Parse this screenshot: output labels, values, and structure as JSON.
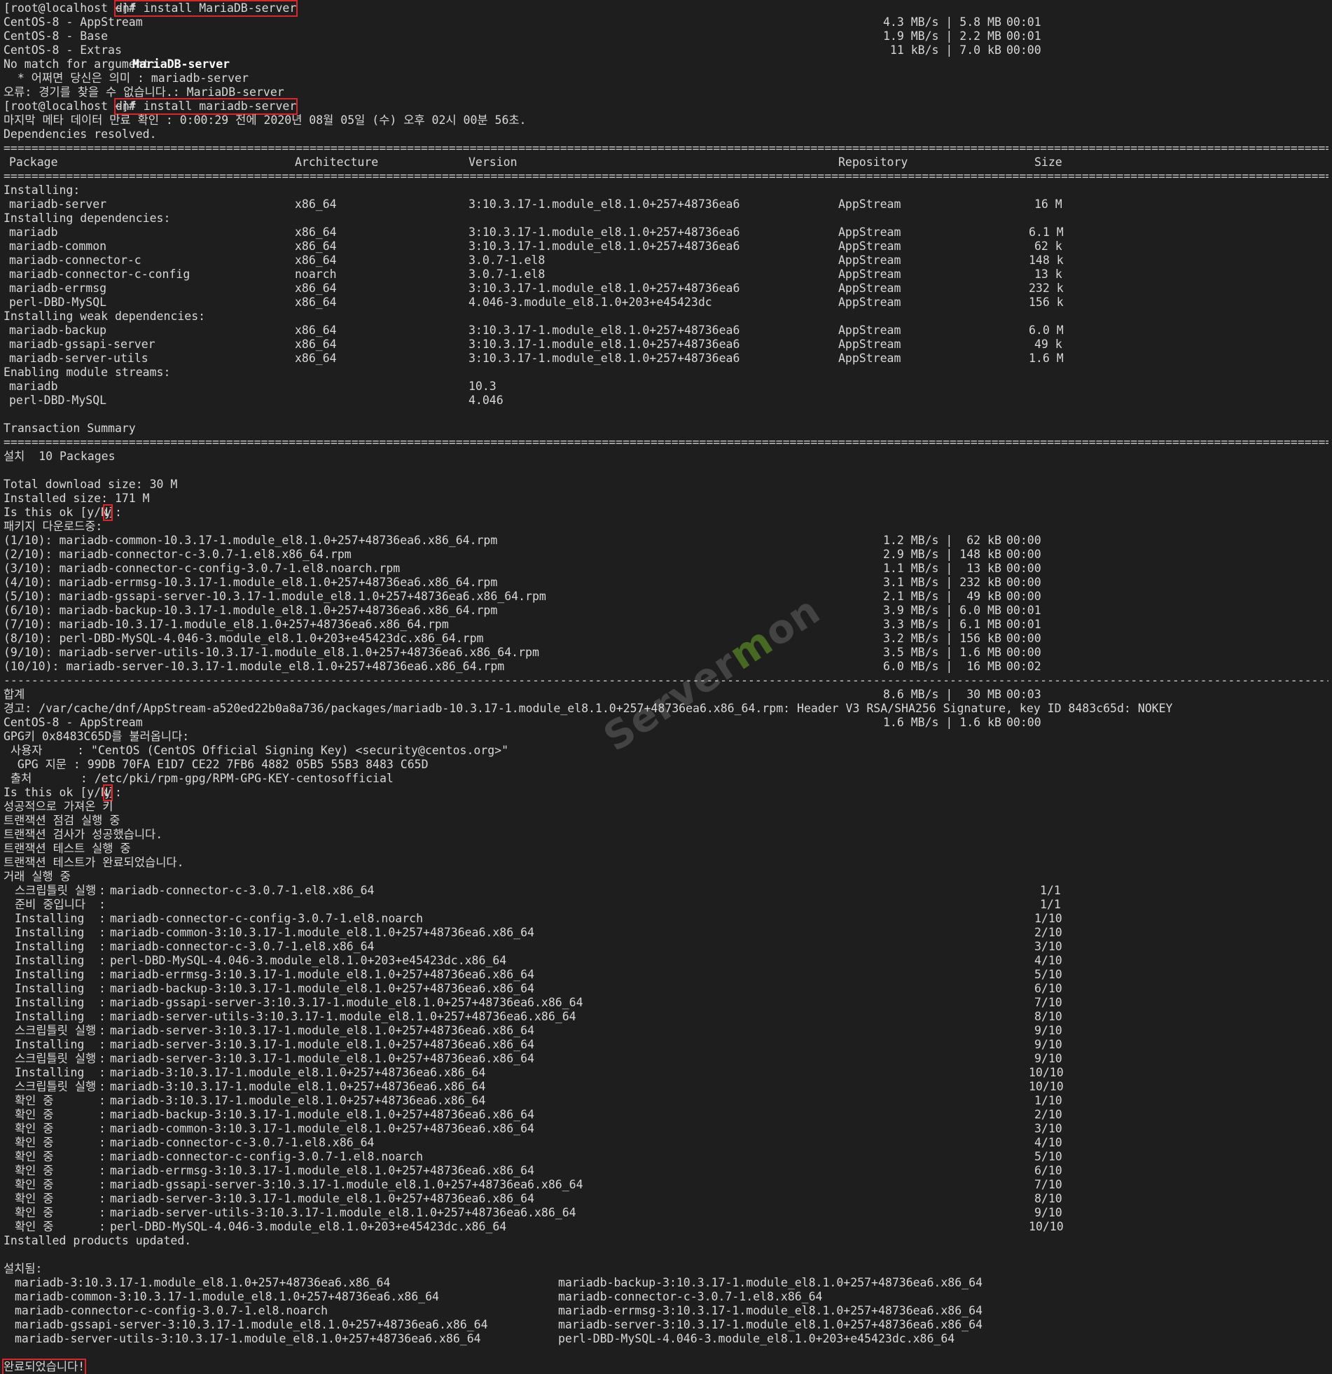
{
  "terminal": {
    "prompt": "[root@localhost ~]#",
    "cmd_wrong": "dnf install MariaDB-server",
    "cmd_right": "dnf install mariadb-server",
    "repo_lines": [
      {
        "name": "CentOS-8 - AppStream",
        "rate": "4.3 MB/s | 5.8 MB",
        "time": "00:01"
      },
      {
        "name": "CentOS-8 - Base",
        "rate": "1.9 MB/s | 2.2 MB",
        "time": "00:01"
      },
      {
        "name": "CentOS-8 - Extras",
        "rate": " 11 kB/s | 7.0 kB",
        "time": "00:00"
      }
    ],
    "no_match_prefix": "No match for argument: ",
    "no_match_pkg": "MariaDB-server",
    "suggest": "  * 어쩌면 당신은 의미 : mariadb-server",
    "error_line": "오류: 경기를 찾을 수 없습니다.: MariaDB-server",
    "metadata_line": "마지막 메타 데이터 만료 확인 : 0:00:29 전에 2020년 08월 05일 (수) 오후 02시 00분 56초.",
    "deps_resolved": "Dependencies resolved.",
    "header": {
      "package": "Package",
      "arch": "Architecture",
      "version": "Version",
      "repo": "Repository",
      "size": "Size"
    },
    "sections": [
      {
        "title": "Installing:",
        "rows": [
          {
            "pkg": "mariadb-server",
            "arch": "x86_64",
            "ver": "3:10.3.17-1.module_el8.1.0+257+48736ea6",
            "repo": "AppStream",
            "size": "16 M"
          }
        ]
      },
      {
        "title": "Installing dependencies:",
        "rows": [
          {
            "pkg": "mariadb",
            "arch": "x86_64",
            "ver": "3:10.3.17-1.module_el8.1.0+257+48736ea6",
            "repo": "AppStream",
            "size": "6.1 M"
          },
          {
            "pkg": "mariadb-common",
            "arch": "x86_64",
            "ver": "3:10.3.17-1.module_el8.1.0+257+48736ea6",
            "repo": "AppStream",
            "size": "62 k"
          },
          {
            "pkg": "mariadb-connector-c",
            "arch": "x86_64",
            "ver": "3.0.7-1.el8",
            "repo": "AppStream",
            "size": "148 k"
          },
          {
            "pkg": "mariadb-connector-c-config",
            "arch": "noarch",
            "ver": "3.0.7-1.el8",
            "repo": "AppStream",
            "size": "13 k"
          },
          {
            "pkg": "mariadb-errmsg",
            "arch": "x86_64",
            "ver": "3:10.3.17-1.module_el8.1.0+257+48736ea6",
            "repo": "AppStream",
            "size": "232 k"
          },
          {
            "pkg": "perl-DBD-MySQL",
            "arch": "x86_64",
            "ver": "4.046-3.module_el8.1.0+203+e45423dc",
            "repo": "AppStream",
            "size": "156 k"
          }
        ]
      },
      {
        "title": "Installing weak dependencies:",
        "rows": [
          {
            "pkg": "mariadb-backup",
            "arch": "x86_64",
            "ver": "3:10.3.17-1.module_el8.1.0+257+48736ea6",
            "repo": "AppStream",
            "size": "6.0 M"
          },
          {
            "pkg": "mariadb-gssapi-server",
            "arch": "x86_64",
            "ver": "3:10.3.17-1.module_el8.1.0+257+48736ea6",
            "repo": "AppStream",
            "size": "49 k"
          },
          {
            "pkg": "mariadb-server-utils",
            "arch": "x86_64",
            "ver": "3:10.3.17-1.module_el8.1.0+257+48736ea6",
            "repo": "AppStream",
            "size": "1.6 M"
          }
        ]
      },
      {
        "title": "Enabling module streams:",
        "rows": [
          {
            "pkg": "mariadb",
            "arch": "",
            "ver": "10.3",
            "repo": "",
            "size": ""
          },
          {
            "pkg": "perl-DBD-MySQL",
            "arch": "",
            "ver": "4.046",
            "repo": "",
            "size": ""
          }
        ]
      }
    ],
    "txn_summary": "Transaction Summary",
    "install_count": "설치  10 Packages",
    "total_download": "Total download size: 30 M",
    "installed_size": "Installed size: 171 M",
    "ok_prompt": "Is this ok [y/N]: ",
    "answer": "y",
    "downloading": "패키지 다운로드중:",
    "downloads": [
      {
        "file": "(1/10): mariadb-common-10.3.17-1.module_el8.1.0+257+48736ea6.x86_64.rpm",
        "rate": "1.2 MB/s |  62 kB",
        "time": "00:00"
      },
      {
        "file": "(2/10): mariadb-connector-c-3.0.7-1.el8.x86_64.rpm",
        "rate": "2.9 MB/s | 148 kB",
        "time": "00:00"
      },
      {
        "file": "(3/10): mariadb-connector-c-config-3.0.7-1.el8.noarch.rpm",
        "rate": "1.1 MB/s |  13 kB",
        "time": "00:00"
      },
      {
        "file": "(4/10): mariadb-errmsg-10.3.17-1.module_el8.1.0+257+48736ea6.x86_64.rpm",
        "rate": "3.1 MB/s | 232 kB",
        "time": "00:00"
      },
      {
        "file": "(5/10): mariadb-gssapi-server-10.3.17-1.module_el8.1.0+257+48736ea6.x86_64.rpm",
        "rate": "2.1 MB/s |  49 kB",
        "time": "00:00"
      },
      {
        "file": "(6/10): mariadb-backup-10.3.17-1.module_el8.1.0+257+48736ea6.x86_64.rpm",
        "rate": "3.9 MB/s | 6.0 MB",
        "time": "00:01"
      },
      {
        "file": "(7/10): mariadb-10.3.17-1.module_el8.1.0+257+48736ea6.x86_64.rpm",
        "rate": "3.3 MB/s | 6.1 MB",
        "time": "00:01"
      },
      {
        "file": "(8/10): perl-DBD-MySQL-4.046-3.module_el8.1.0+203+e45423dc.x86_64.rpm",
        "rate": "3.2 MB/s | 156 kB",
        "time": "00:00"
      },
      {
        "file": "(9/10): mariadb-server-utils-10.3.17-1.module_el8.1.0+257+48736ea6.x86_64.rpm",
        "rate": "3.5 MB/s | 1.6 MB",
        "time": "00:00"
      },
      {
        "file": "(10/10): mariadb-server-10.3.17-1.module_el8.1.0+257+48736ea6.x86_64.rpm",
        "rate": "6.0 MB/s |  16 MB",
        "time": "00:02"
      }
    ],
    "total_label": "합계",
    "total_rate": "8.6 MB/s |  30 MB",
    "total_time": "00:03",
    "warning_line": "경고: /var/cache/dnf/AppStream-a520ed22b0a8a736/packages/mariadb-10.3.17-1.module_el8.1.0+257+48736ea6.x86_64.rpm: Header V3 RSA/SHA256 Signature, key ID 8483c65d: NOKEY",
    "appstream_line": {
      "name": "CentOS-8 - AppStream",
      "rate": "1.6 MB/s | 1.6 kB",
      "time": "00:00"
    },
    "gpg_lines": [
      "GPG키 0x8483C65D를 불러옵니다:",
      " 사용자     : \"CentOS (CentOS Official Signing Key) <security@centos.org>\"",
      "  GPG 지문 : 99DB 70FA E1D7 CE22 7FB6 4882 05B5 55B3 8483 C65D",
      " 출처       : /etc/pki/rpm-gpg/RPM-GPG-KEY-centosofficial"
    ],
    "post_lines": [
      "성공적으로 가져온 키",
      "트랜잭션 점검 실행 중",
      "트랜잭션 검사가 성공했습니다.",
      "트랜잭션 테스트 실행 중",
      "트랜잭션 테스트가 완료되었습니다.",
      "거래 실행 중"
    ],
    "steps": [
      {
        "action": "스크립틀릿 실행",
        "pkg": "mariadb-connector-c-3.0.7-1.el8.x86_64",
        "prog": "1/1"
      },
      {
        "action": "준비 중입니다",
        "pkg": "",
        "prog": "1/1"
      },
      {
        "action": "Installing",
        "pkg": "mariadb-connector-c-config-3.0.7-1.el8.noarch",
        "prog": "1/10"
      },
      {
        "action": "Installing",
        "pkg": "mariadb-common-3:10.3.17-1.module_el8.1.0+257+48736ea6.x86_64",
        "prog": "2/10"
      },
      {
        "action": "Installing",
        "pkg": "mariadb-connector-c-3.0.7-1.el8.x86_64",
        "prog": "3/10"
      },
      {
        "action": "Installing",
        "pkg": "perl-DBD-MySQL-4.046-3.module_el8.1.0+203+e45423dc.x86_64",
        "prog": "4/10"
      },
      {
        "action": "Installing",
        "pkg": "mariadb-errmsg-3:10.3.17-1.module_el8.1.0+257+48736ea6.x86_64",
        "prog": "5/10"
      },
      {
        "action": "Installing",
        "pkg": "mariadb-backup-3:10.3.17-1.module_el8.1.0+257+48736ea6.x86_64",
        "prog": "6/10"
      },
      {
        "action": "Installing",
        "pkg": "mariadb-gssapi-server-3:10.3.17-1.module_el8.1.0+257+48736ea6.x86_64",
        "prog": "7/10"
      },
      {
        "action": "Installing",
        "pkg": "mariadb-server-utils-3:10.3.17-1.module_el8.1.0+257+48736ea6.x86_64",
        "prog": "8/10"
      },
      {
        "action": "스크립틀릿 실행",
        "pkg": "mariadb-server-3:10.3.17-1.module_el8.1.0+257+48736ea6.x86_64",
        "prog": "9/10"
      },
      {
        "action": "Installing",
        "pkg": "mariadb-server-3:10.3.17-1.module_el8.1.0+257+48736ea6.x86_64",
        "prog": "9/10"
      },
      {
        "action": "스크립틀릿 실행",
        "pkg": "mariadb-server-3:10.3.17-1.module_el8.1.0+257+48736ea6.x86_64",
        "prog": "9/10"
      },
      {
        "action": "Installing",
        "pkg": "mariadb-3:10.3.17-1.module_el8.1.0+257+48736ea6.x86_64",
        "prog": "10/10"
      },
      {
        "action": "스크립틀릿 실행",
        "pkg": "mariadb-3:10.3.17-1.module_el8.1.0+257+48736ea6.x86_64",
        "prog": "10/10"
      },
      {
        "action": "확인 중",
        "pkg": "mariadb-3:10.3.17-1.module_el8.1.0+257+48736ea6.x86_64",
        "prog": "1/10"
      },
      {
        "action": "확인 중",
        "pkg": "mariadb-backup-3:10.3.17-1.module_el8.1.0+257+48736ea6.x86_64",
        "prog": "2/10"
      },
      {
        "action": "확인 중",
        "pkg": "mariadb-common-3:10.3.17-1.module_el8.1.0+257+48736ea6.x86_64",
        "prog": "3/10"
      },
      {
        "action": "확인 중",
        "pkg": "mariadb-connector-c-3.0.7-1.el8.x86_64",
        "prog": "4/10"
      },
      {
        "action": "확인 중",
        "pkg": "mariadb-connector-c-config-3.0.7-1.el8.noarch",
        "prog": "5/10"
      },
      {
        "action": "확인 중",
        "pkg": "mariadb-errmsg-3:10.3.17-1.module_el8.1.0+257+48736ea6.x86_64",
        "prog": "6/10"
      },
      {
        "action": "확인 중",
        "pkg": "mariadb-gssapi-server-3:10.3.17-1.module_el8.1.0+257+48736ea6.x86_64",
        "prog": "7/10"
      },
      {
        "action": "확인 중",
        "pkg": "mariadb-server-3:10.3.17-1.module_el8.1.0+257+48736ea6.x86_64",
        "prog": "8/10"
      },
      {
        "action": "확인 중",
        "pkg": "mariadb-server-utils-3:10.3.17-1.module_el8.1.0+257+48736ea6.x86_64",
        "prog": "9/10"
      },
      {
        "action": "확인 중",
        "pkg": "perl-DBD-MySQL-4.046-3.module_el8.1.0+203+e45423dc.x86_64",
        "prog": "10/10"
      }
    ],
    "products_updated": "Installed products updated.",
    "installed_label": "설치됨:",
    "installed_pkgs": [
      [
        "mariadb-3:10.3.17-1.module_el8.1.0+257+48736ea6.x86_64",
        "mariadb-backup-3:10.3.17-1.module_el8.1.0+257+48736ea6.x86_64"
      ],
      [
        "mariadb-common-3:10.3.17-1.module_el8.1.0+257+48736ea6.x86_64",
        "mariadb-connector-c-3.0.7-1.el8.x86_64"
      ],
      [
        "mariadb-connector-c-config-3.0.7-1.el8.noarch",
        "mariadb-errmsg-3:10.3.17-1.module_el8.1.0+257+48736ea6.x86_64"
      ],
      [
        "mariadb-gssapi-server-3:10.3.17-1.module_el8.1.0+257+48736ea6.x86_64",
        "mariadb-server-3:10.3.17-1.module_el8.1.0+257+48736ea6.x86_64"
      ],
      [
        "mariadb-server-utils-3:10.3.17-1.module_el8.1.0+257+48736ea6.x86_64",
        "perl-DBD-MySQL-4.046-3.module_el8.1.0+203+e45423dc.x86_64"
      ]
    ],
    "complete": "완료되었습니다!",
    "watermark": {
      "pre": "Server",
      "accent": "m",
      "post": "on"
    },
    "colors": {
      "background": "#1e1e1e",
      "text": "#d8d8d8",
      "highlight_box": "#e0242c"
    }
  }
}
